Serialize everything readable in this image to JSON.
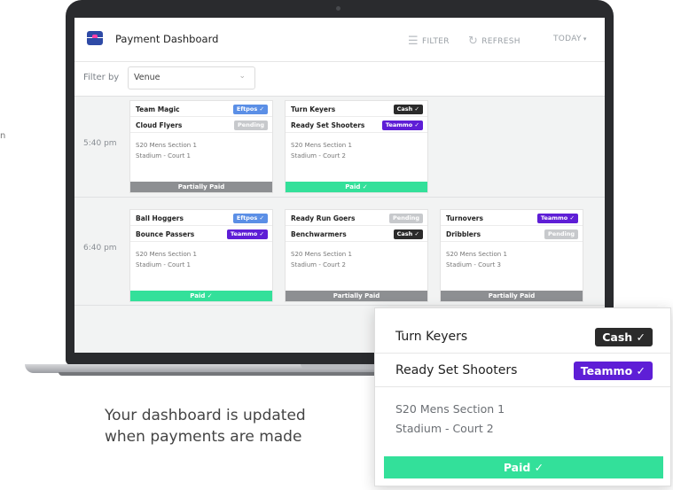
{
  "app": {
    "title": "Payment Dashboard"
  },
  "header": {
    "filter_label": "FILTER",
    "refresh_label": "REFRESH",
    "today_label": "TODAY"
  },
  "filter": {
    "label": "Filter by",
    "value": "Venue"
  },
  "side_fragment": "n",
  "rows": [
    {
      "time": "5:40 pm",
      "games": [
        {
          "team1": "Team Magic",
          "badge1": "Eftpos",
          "team2": "Cloud Flyers",
          "badge2": "Pending",
          "section": "S20 Mens Section 1",
          "court": "Stadium - Court 1",
          "status": "Partially Paid"
        },
        {
          "team1": "Turn Keyers",
          "badge1": "Cash",
          "team2": "Ready Set Shooters",
          "badge2": "Teammo",
          "section": "S20 Mens Section 1",
          "court": "Stadium - Court 2",
          "status": "Paid"
        }
      ]
    },
    {
      "time": "6:40 pm",
      "games": [
        {
          "team1": "Ball Hoggers",
          "badge1": "Eftpos",
          "team2": "Bounce Passers",
          "badge2": "Teammo",
          "section": "S20 Mens Section 1",
          "court": "Stadium - Court 1",
          "status": "Paid"
        },
        {
          "team1": "Ready Run Goers",
          "badge1": "Pending",
          "team2": "Benchwarmers",
          "badge2": "Cash",
          "section": "S20 Mens Section 1",
          "court": "Stadium - Court 2",
          "status": "Partially Paid"
        },
        {
          "team1": "Turnovers",
          "badge1": "Teammo",
          "team2": "Dribblers",
          "badge2": "Pending",
          "section": "S20 Mens Section 1",
          "court": "Stadium - Court 3",
          "status": "Partially Paid"
        }
      ]
    }
  ],
  "zoom": {
    "team1": "Turn Keyers",
    "badge1": "Cash",
    "team2": "Ready Set Shooters",
    "badge2": "Teammo",
    "section": "S20 Mens Section 1",
    "court": "Stadium - Court 2",
    "status": "Paid"
  },
  "caption": {
    "line1": "Your dashboard is updated",
    "line2": "when payments are made"
  },
  "colors": {
    "eftpos": "#5b8fe6",
    "cash": "#2b2b2b",
    "teammo": "#5e1ed6",
    "pending": "#c7c9cc",
    "paid": "#33e09a",
    "partial": "#8d8f92",
    "brand": "#2e4aa6",
    "brand_accent": "#ff3ea5"
  }
}
